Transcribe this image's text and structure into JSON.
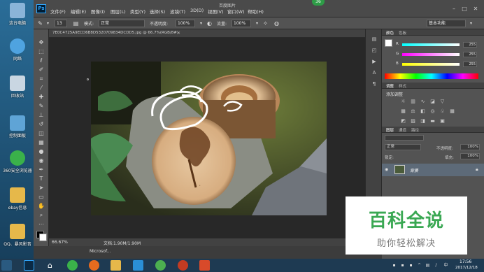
{
  "desktop": {
    "icons": [
      {
        "label": "这台电脑",
        "color": "#8ab4d8"
      },
      {
        "label": "网络",
        "color": "#4fa3e0"
      },
      {
        "label": "回收站",
        "color": "#c9d6e2"
      },
      {
        "label": "控制面板",
        "color": "#5fa4d6"
      },
      {
        "label": "360安全浏览器",
        "color": "#3ab14a"
      },
      {
        "label": "ebay信息",
        "color": "#e6b84a"
      },
      {
        "label": "QQ、暴风影音",
        "color": "#e6b84a"
      }
    ],
    "partial_labels": [
      "亚",
      "新",
      "新"
    ]
  },
  "ps": {
    "logo": "Ps",
    "menu": [
      "文件(F)",
      "编辑(E)",
      "图像(I)",
      "图层(L)",
      "类型(Y)",
      "选择(S)",
      "滤镜(T)",
      "3D(D)",
      "视图(V)",
      "窗口(W)",
      "帮助(H)"
    ],
    "window_title": "百度图片",
    "badge": "36",
    "options": {
      "mode_label": "模式:",
      "mode_value": "正常",
      "opacity_label": "不透明度:",
      "opacity_value": "100%",
      "flow_label": "流量:",
      "flow_value": "100%",
      "brush_size": "13",
      "workspace": "基本功能"
    },
    "doc_tab": "7E0C4725A9ECD6B8D5320709834DCDD5.jpg @ 66.7%(RGB/8#)",
    "status": {
      "zoom": "66.67%",
      "doc": "文档:1.90M/1.90M"
    },
    "taskbar_mini": "Microsof..."
  },
  "panels": {
    "color_tabs": [
      "颜色",
      "色板"
    ],
    "sliders": [
      {
        "channel": "R",
        "value": "255",
        "gradient": "linear-gradient(90deg,#00ffff,#ffffff)"
      },
      {
        "channel": "G",
        "value": "255",
        "gradient": "linear-gradient(90deg,#ff00ff,#ffffff)"
      },
      {
        "channel": "B",
        "value": "255",
        "gradient": "linear-gradient(90deg,#ffff00,#ffffff)"
      }
    ],
    "adjust_tabs": [
      "调整",
      "样式"
    ],
    "adjust_title": "添加调整",
    "layer_tabs": [
      "图层",
      "通道",
      "路径"
    ],
    "blend_mode": "正常",
    "opacity_label": "不透明度:",
    "opacity_value": "100%",
    "lock_label": "锁定:",
    "fill_label": "填充:",
    "fill_value": "100%",
    "layer_name": "背景"
  },
  "watermark": {
    "title": "百科全说",
    "subtitle": "助你轻松解决"
  },
  "taskbar": {
    "time": "17:56",
    "date": "2017/12/18",
    "apps": [
      {
        "name": "photoshop",
        "color": "#0b2a44"
      },
      {
        "name": "home",
        "color": "#1e3a52"
      },
      {
        "name": "360",
        "color": "#3ab14a"
      },
      {
        "name": "firefox",
        "color": "#e66b1e"
      },
      {
        "name": "explorer",
        "color": "#e6b84a"
      },
      {
        "name": "w",
        "color": "#2a8fd6"
      },
      {
        "name": "chrome",
        "color": "#4caf50"
      },
      {
        "name": "game",
        "color": "#c23b22"
      },
      {
        "name": "media",
        "color": "#d84a2a"
      }
    ]
  }
}
